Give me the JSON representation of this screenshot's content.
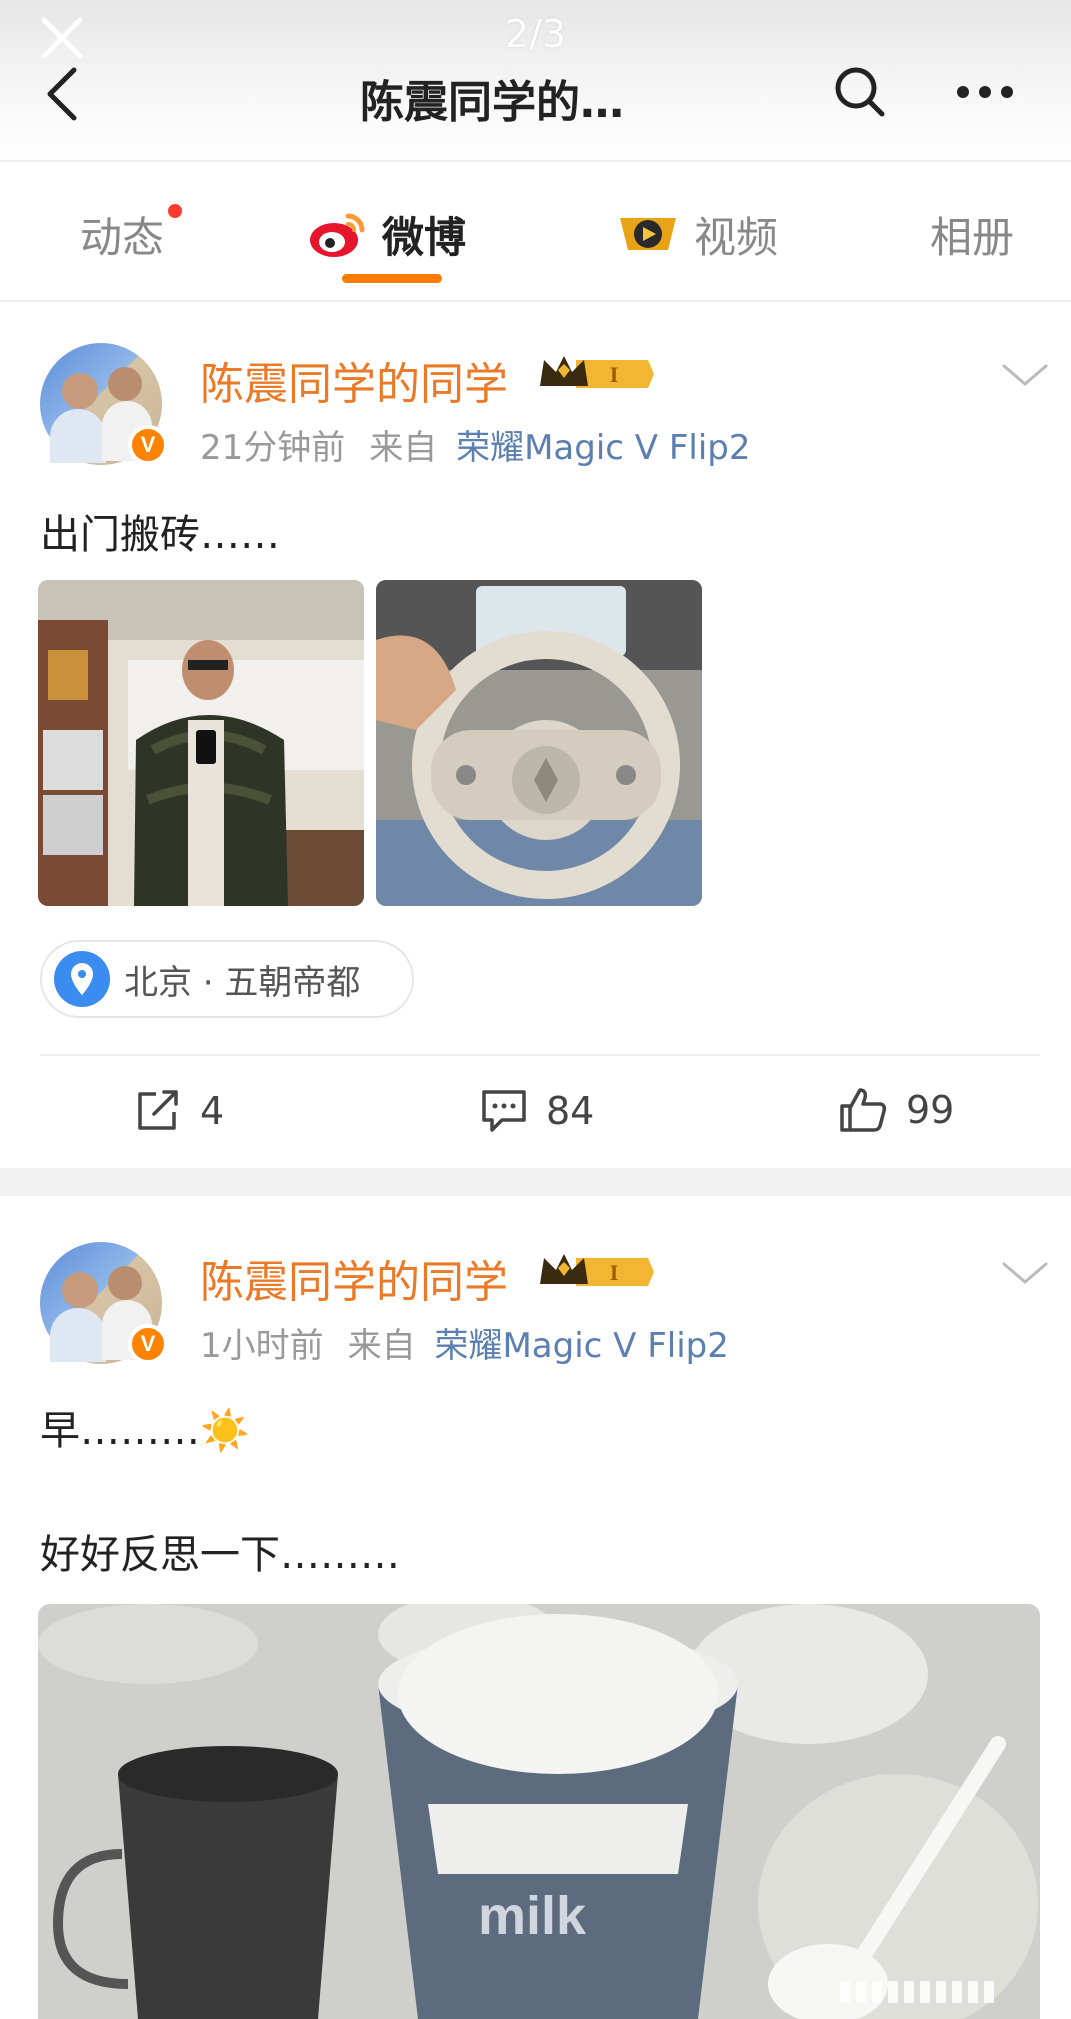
{
  "topbar": {
    "pager": "2/3",
    "title": "陈震同学的…"
  },
  "tabs": [
    {
      "label": "动态"
    },
    {
      "label": "微博"
    },
    {
      "label": "视频"
    },
    {
      "label": "相册"
    }
  ],
  "posts": [
    {
      "username": "陈震同学的同学",
      "level_badge": "I",
      "time": "21分钟前",
      "from_prefix": "来自",
      "source": "荣耀Magic V Flip2",
      "text": "出门搬砖……",
      "location": "北京 · 五朝帝都",
      "reposts": "4",
      "comments": "84",
      "likes": "99"
    },
    {
      "username": "陈震同学的同学",
      "level_badge": "I",
      "time": "1小时前",
      "from_prefix": "来自",
      "source": "荣耀Magic V Flip2",
      "text_line1": "早………☀️",
      "text_line2": "好好反思一下………"
    }
  ],
  "colors": {
    "username": "#ea7a27",
    "accent": "#ff7a00",
    "link": "#5b7fb0",
    "notice_dot": "#ff3b30"
  },
  "icons": [
    "close-icon",
    "back-icon",
    "search-icon",
    "more-icon",
    "weibo-logo-icon",
    "video-play-icon",
    "chevron-down-icon",
    "location-pin-icon",
    "repost-icon",
    "comment-icon",
    "like-icon",
    "verified-icon",
    "crown-icon"
  ]
}
